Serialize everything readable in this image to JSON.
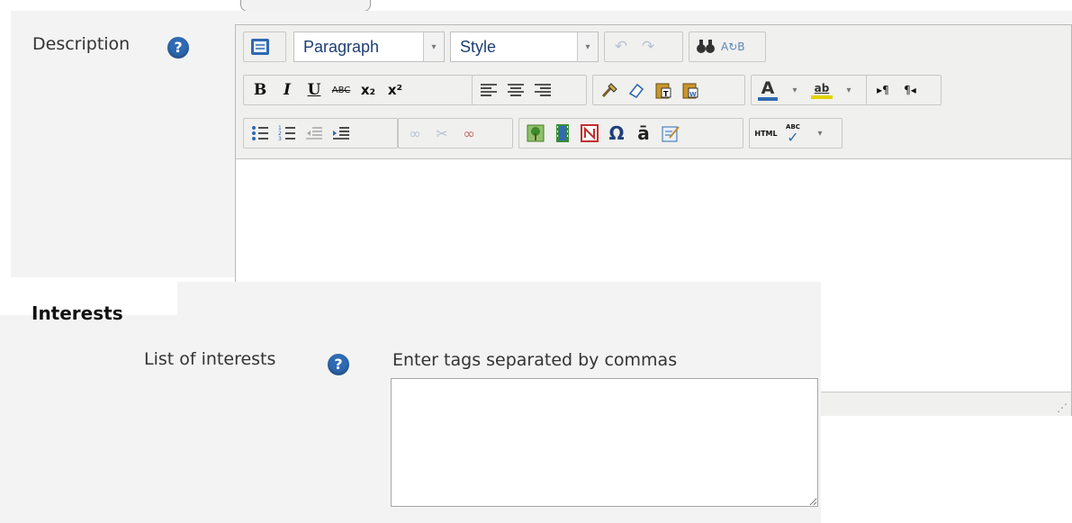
{
  "description": {
    "label": "Description",
    "help_icon": "?"
  },
  "editor": {
    "block_format": {
      "selected": "Paragraph"
    },
    "style_select": {
      "selected": "Style"
    },
    "row1_icons": [
      "undo-icon",
      "redo-icon",
      "find-icon",
      "replace-icon"
    ],
    "row2": {
      "bold": "B",
      "italic": "I",
      "underline": "U",
      "strikethrough": "ABC",
      "subscript": "x₂",
      "superscript": "x²",
      "text_color": "A",
      "highlight": "ab"
    },
    "row3": {
      "omega": "Ω",
      "char_map": "ā",
      "html": "HTML",
      "spell": "ABC"
    }
  },
  "interests": {
    "heading": "Interests",
    "label": "List of interests",
    "help_icon": "?",
    "hint": "Enter tags separated by commas",
    "value": ""
  }
}
